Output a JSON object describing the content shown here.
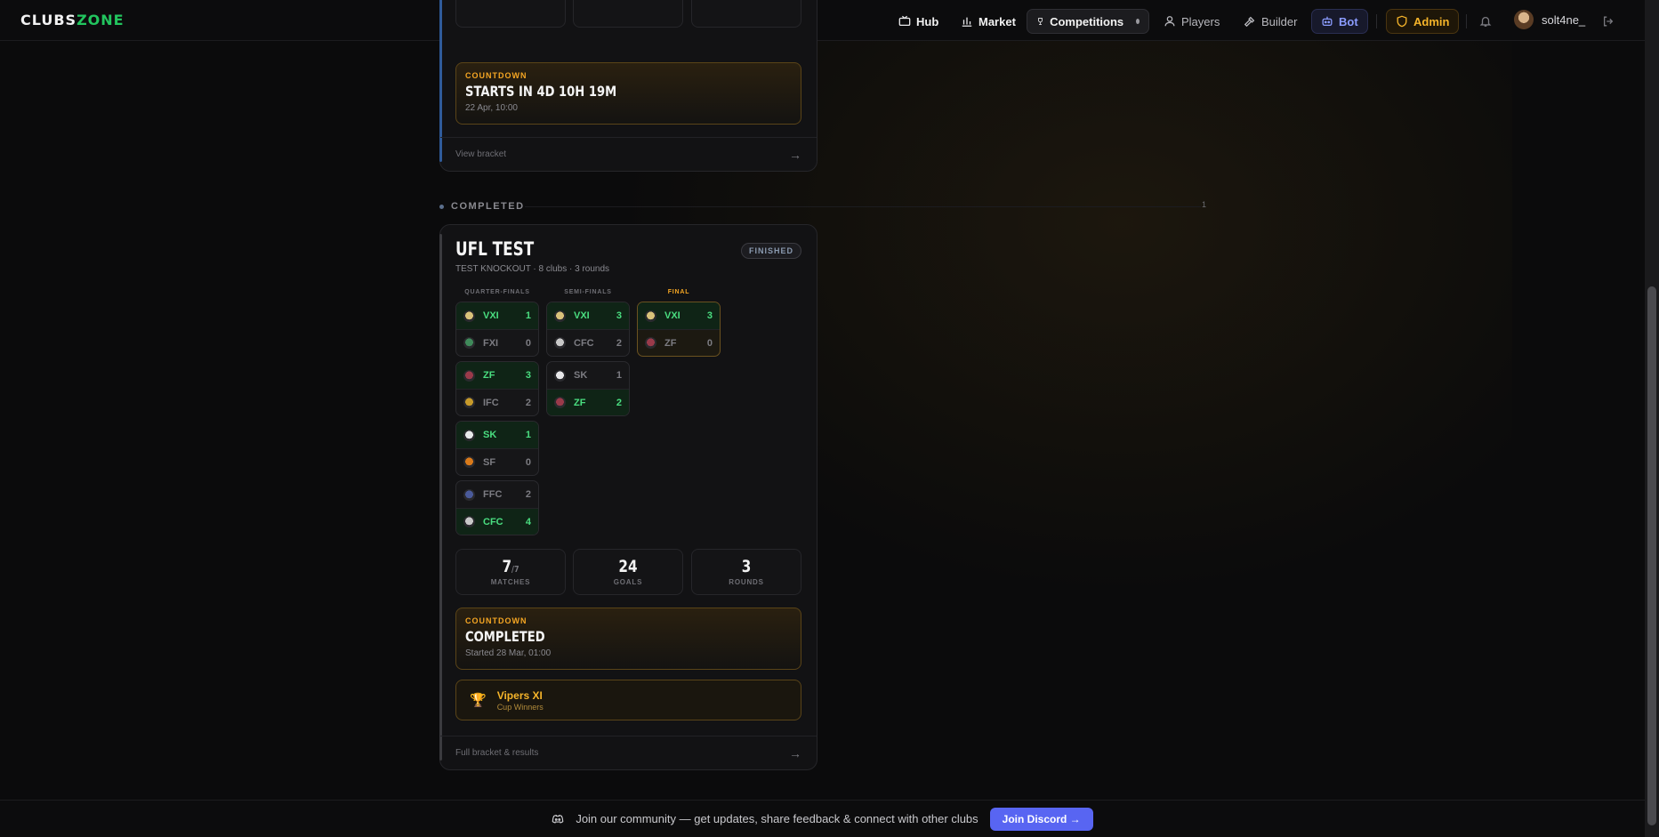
{
  "nav": {
    "logo_a": "CLUBS",
    "logo_b": "ZONE",
    "items": [
      {
        "label": "Hub",
        "icon": "tv-icon"
      },
      {
        "label": "Market",
        "icon": "bar-chart-icon"
      },
      {
        "label": "Competitions",
        "icon": "trophy-icon"
      },
      {
        "label": "Players",
        "icon": "user-icon"
      },
      {
        "label": "Builder",
        "icon": "hammer-icon"
      },
      {
        "label": "Bot",
        "icon": "robot-icon"
      },
      {
        "label": "Admin",
        "icon": "shield-icon"
      }
    ],
    "username": "solt4ne_"
  },
  "upcoming_card": {
    "countdown_label": "COUNTDOWN",
    "countdown_title": "STARTS IN 4D 10H 19M",
    "countdown_sub": "22 Apr, 10:00",
    "footer_link": "View bracket",
    "arrow": "→"
  },
  "section": {
    "label": "COMPLETED",
    "count": "1"
  },
  "completed_card": {
    "title": "UFL TEST",
    "subtitle": "TEST KNOCKOUT · 8 clubs · 3 rounds",
    "badge": "FINISHED",
    "rounds": [
      "QUARTER-FINALS",
      "SEMI-FINALS",
      "FINAL"
    ],
    "quarter_finals": [
      {
        "home": {
          "abbr": "VXI",
          "score": "1",
          "win": true
        },
        "away": {
          "abbr": "FXI",
          "score": "0",
          "win": false
        }
      },
      {
        "home": {
          "abbr": "ZF",
          "score": "3",
          "win": true
        },
        "away": {
          "abbr": "IFC",
          "score": "2",
          "win": false
        }
      },
      {
        "home": {
          "abbr": "SK",
          "score": "1",
          "win": true
        },
        "away": {
          "abbr": "SF",
          "score": "0",
          "win": false
        }
      },
      {
        "home": {
          "abbr": "FFC",
          "score": "2",
          "win": false
        },
        "away": {
          "abbr": "CFC",
          "score": "4",
          "win": true
        }
      }
    ],
    "semi_finals": [
      {
        "home": {
          "abbr": "VXI",
          "score": "3",
          "win": true
        },
        "away": {
          "abbr": "CFC",
          "score": "2",
          "win": false
        }
      },
      {
        "home": {
          "abbr": "SK",
          "score": "1",
          "win": false
        },
        "away": {
          "abbr": "ZF",
          "score": "2",
          "win": true
        }
      }
    ],
    "final": {
      "home": {
        "abbr": "VXI",
        "score": "3",
        "win": true
      },
      "away": {
        "abbr": "ZF",
        "score": "0",
        "win": false
      }
    },
    "stats": {
      "matches_value": "7",
      "matches_total": "/7",
      "matches_label": "MATCHES",
      "goals_value": "24",
      "goals_label": "GOALS",
      "rounds_value": "3",
      "rounds_label": "ROUNDS"
    },
    "countdown_label": "COUNTDOWN",
    "countdown_title": "COMPLETED",
    "countdown_sub": "Started 28 Mar, 01:00",
    "winner_name": "Vipers XI",
    "winner_sub": "Cup Winners",
    "footer_link": "Full bracket & results",
    "arrow": "→"
  },
  "discord": {
    "text": "Join our community — get updates, share feedback & connect with other clubs",
    "button": "Join Discord →"
  },
  "colors": {
    "accent_green": "#22c55e",
    "accent_gold": "#f5a623",
    "discord_blue": "#5865f2"
  }
}
